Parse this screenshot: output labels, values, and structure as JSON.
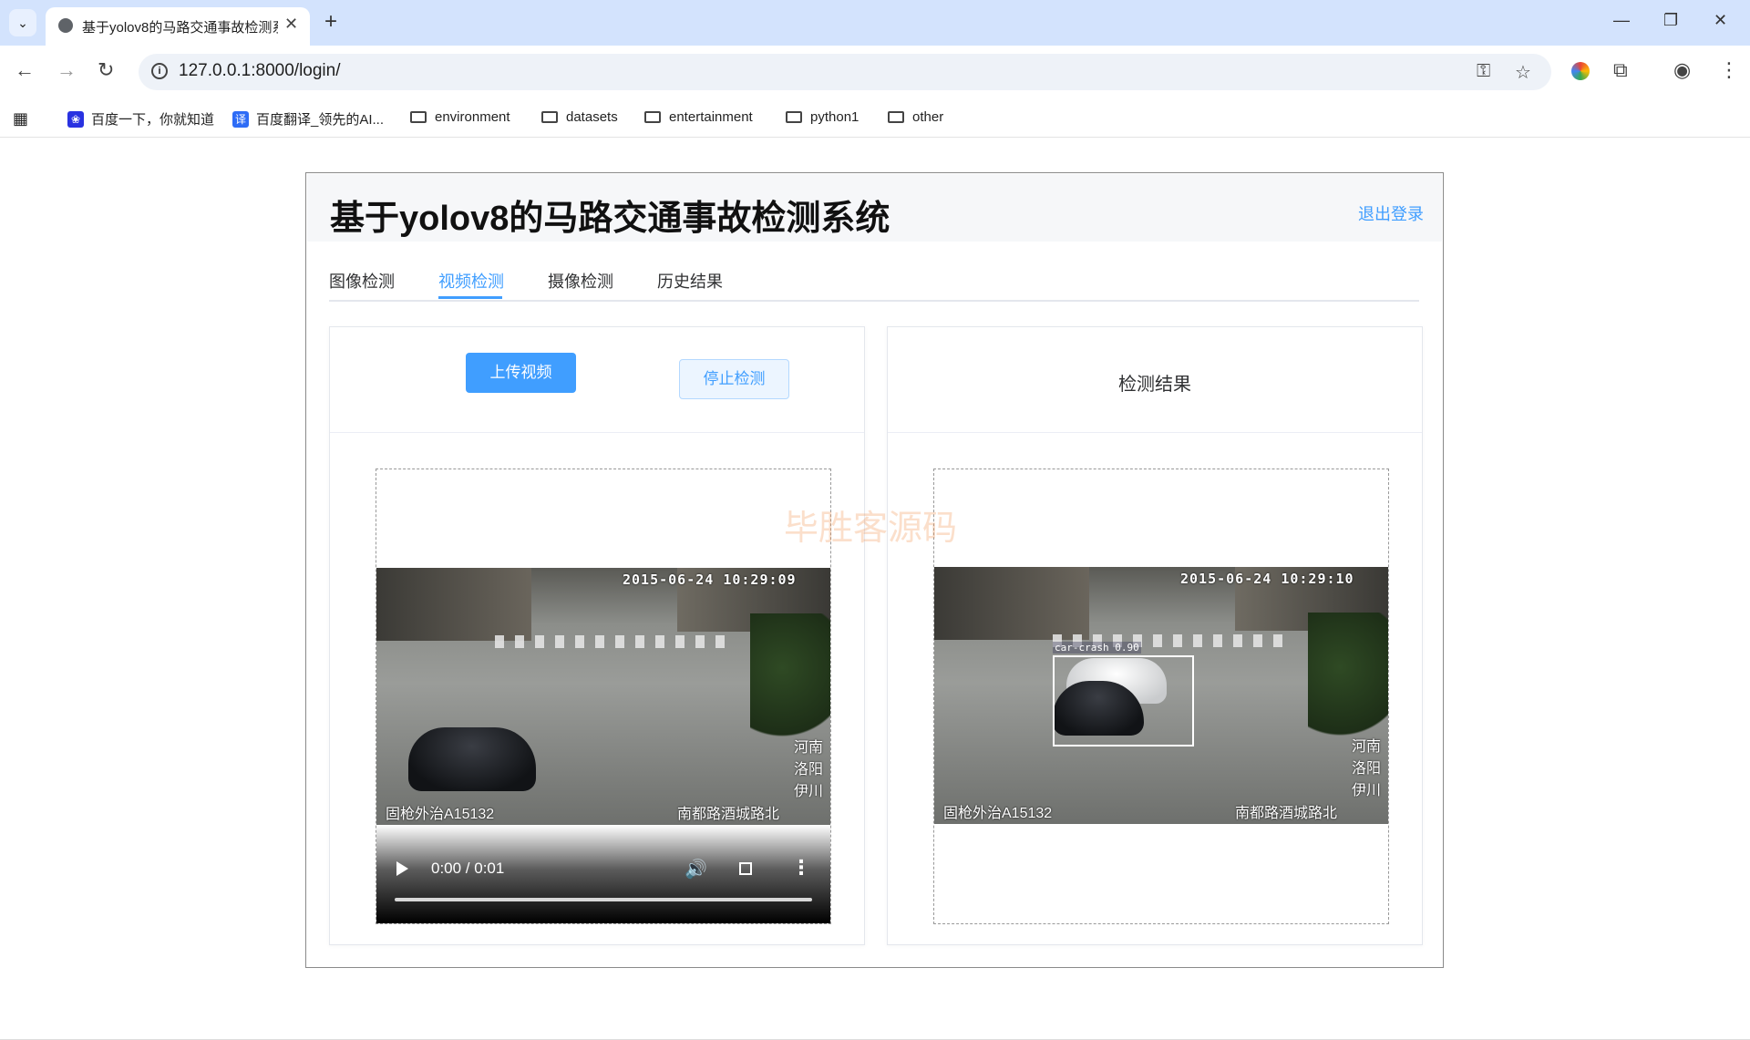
{
  "browser": {
    "tab_title": "基于yolov8的马路交通事故检测系统",
    "url": "127.0.0.1:8000/login/",
    "bookmarks": [
      {
        "label": "百度一下，你就知道",
        "icon": "baidu-icon"
      },
      {
        "label": "百度翻译_领先的AI...",
        "icon": "translate-icon",
        "badge": "译"
      },
      {
        "label": "environment",
        "icon": "folder-icon"
      },
      {
        "label": "datasets",
        "icon": "folder-icon"
      },
      {
        "label": "entertainment",
        "icon": "folder-icon"
      },
      {
        "label": "python1",
        "icon": "folder-icon"
      },
      {
        "label": "other",
        "icon": "folder-icon"
      }
    ]
  },
  "app": {
    "title": "基于yolov8的马路交通事故检测系统",
    "logout": "退出登录",
    "tabs": [
      {
        "label": "图像检测",
        "active": false
      },
      {
        "label": "视频检测",
        "active": true
      },
      {
        "label": "摄像检测",
        "active": false
      },
      {
        "label": "历史结果",
        "active": false
      }
    ],
    "left_panel": {
      "upload_button": "上传视频",
      "stop_button": "停止检测",
      "video": {
        "timestamp": "2015-06-24 10:29:09",
        "caption_left": "固枪外治A15132",
        "caption_right": "南都路酒城路北",
        "side_tags": [
          "河南",
          "洛阳",
          "伊川"
        ],
        "time": "0:00 / 0:01",
        "progress": 0
      }
    },
    "right_panel": {
      "title": "检测结果",
      "frame": {
        "timestamp": "2015-06-24 10:29:10",
        "caption_left": "固枪外治A15132",
        "caption_right": "南都路酒城路北",
        "side_tags": [
          "河南",
          "洛阳",
          "伊川"
        ],
        "detection_label": "car-crash 0.90"
      }
    },
    "watermark": "毕胜客源码"
  },
  "colors": {
    "accent": "#409eff",
    "tab_strip": "#d3e3fd",
    "header_bg": "#f6f7f9"
  }
}
